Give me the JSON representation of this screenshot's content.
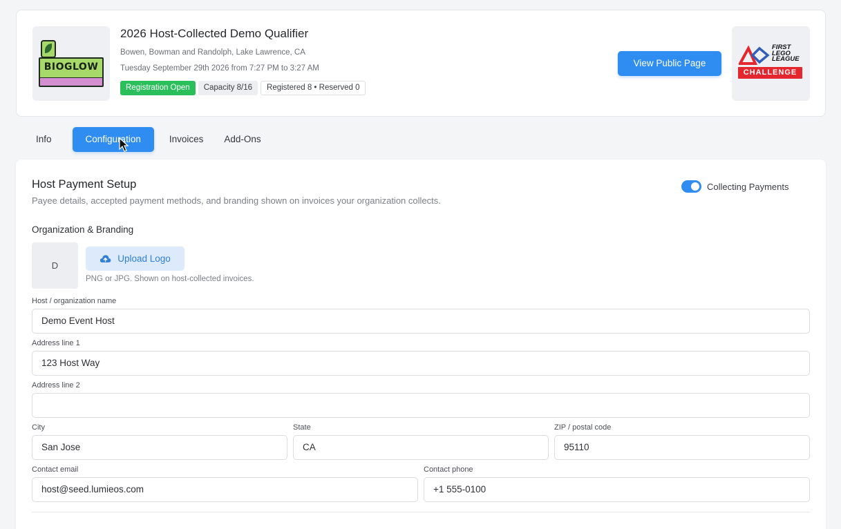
{
  "event": {
    "title": "2026 Host-Collected Demo Qualifier",
    "location": "Bowen, Bowman and Randolph, Lake Lawrence, CA",
    "datetime": "Tuesday September 29th 2026 from 7:27 PM to 3:27 AM",
    "badges": {
      "status": "Registration Open",
      "capacity": "Capacity 8/16",
      "registered": "Registered 8 • Reserved 0"
    },
    "view_public_label": "View Public Page",
    "season_logo_text": "BIOGLOW",
    "program_logo": {
      "line1": "FIRST",
      "line2": "LEGO",
      "line3": "LEAGUE",
      "challenge": "CHALLENGE"
    }
  },
  "tabs": [
    {
      "label": "Info",
      "active": false
    },
    {
      "label": "Configuration",
      "active": true
    },
    {
      "label": "Invoices",
      "active": false
    },
    {
      "label": "Add-Ons",
      "active": false
    }
  ],
  "payment": {
    "title": "Host Payment Setup",
    "subtitle": "Payee details, accepted payment methods, and branding shown on invoices your organization collects.",
    "toggle_label": "Collecting Payments",
    "toggle_on": true,
    "branding_title": "Organization & Branding",
    "logo_placeholder": "D",
    "upload_label": "Upload Logo",
    "upload_hint": "PNG or JPG. Shown on host-collected invoices.",
    "fields": {
      "host_name": {
        "label": "Host / organization name",
        "value": "Demo Event Host"
      },
      "address1": {
        "label": "Address line 1",
        "value": "123 Host Way"
      },
      "address2": {
        "label": "Address line 2",
        "value": ""
      },
      "city": {
        "label": "City",
        "value": "San Jose"
      },
      "state": {
        "label": "State",
        "value": "CA"
      },
      "zip": {
        "label": "ZIP / postal code",
        "value": "95110"
      },
      "email": {
        "label": "Contact email",
        "value": "host@seed.lumieos.com"
      },
      "phone": {
        "label": "Contact phone",
        "value": "+1 555-0100"
      }
    }
  },
  "colors": {
    "primary": "#2f8cf0",
    "success": "#2bbf5c",
    "fll_red": "#e4262f"
  }
}
